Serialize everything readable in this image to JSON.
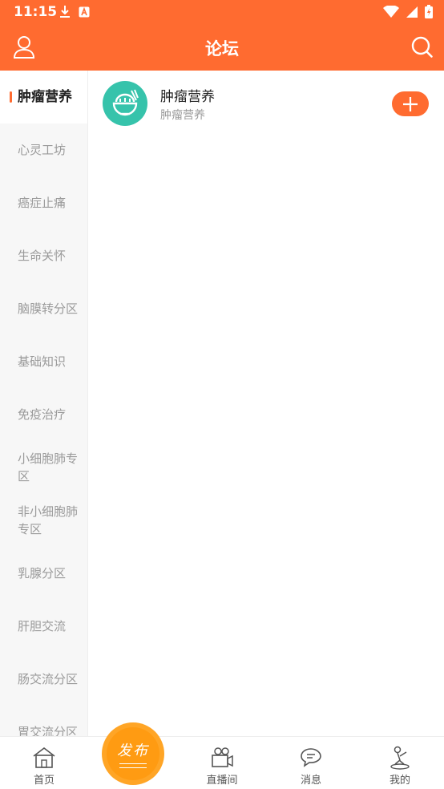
{
  "status_bar": {
    "time": "11:15",
    "icons": [
      "download-icon",
      "a-notification-icon",
      "wifi-icon",
      "signal-icon",
      "battery-charging-icon"
    ]
  },
  "app_bar": {
    "title": "论坛",
    "left_icon": "user-icon",
    "right_icon": "search-icon"
  },
  "sidebar": {
    "items": [
      {
        "label": "肿瘤营养",
        "active": true
      },
      {
        "label": "心灵工坊"
      },
      {
        "label": "癌症止痛"
      },
      {
        "label": "生命关怀"
      },
      {
        "label": "脑膜转分区"
      },
      {
        "label": "基础知识"
      },
      {
        "label": "免疫治疗"
      },
      {
        "label": "小细胞肺专区"
      },
      {
        "label": "非小细胞肺专区"
      },
      {
        "label": "乳腺分区"
      },
      {
        "label": "肝胆交流"
      },
      {
        "label": "肠交流分区"
      },
      {
        "label": "胃交流分区"
      }
    ]
  },
  "forums": [
    {
      "name": "肿瘤营养",
      "description": "肿瘤营养",
      "avatar_icon": "food-bowl-icon",
      "action_icon": "plus-icon"
    }
  ],
  "bottom_nav": {
    "items": [
      {
        "label": "首页",
        "icon": "home-icon"
      },
      {
        "label": "直播间",
        "icon": "video-camera-icon"
      },
      {
        "label": "消息",
        "icon": "chat-bubble-icon"
      },
      {
        "label": "我的",
        "icon": "profile-figure-icon"
      }
    ],
    "publish_label": "发布"
  },
  "colors": {
    "accent": "#ff6b30",
    "publish": "#ff9b12",
    "forum_avatar": "#36c3ab",
    "sidebar_bg": "#f7f7f7"
  }
}
